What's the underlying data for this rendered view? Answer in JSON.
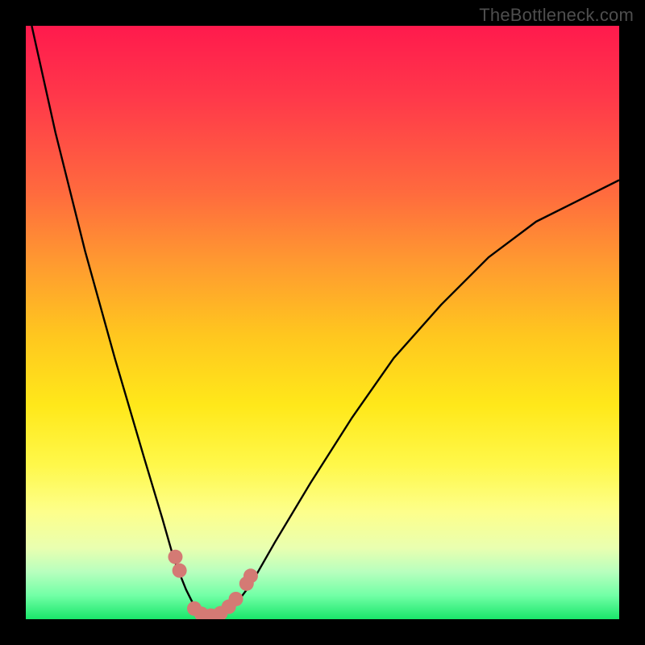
{
  "watermark": "TheBottleneck.com",
  "chart_data": {
    "type": "line",
    "title": "",
    "xlabel": "",
    "ylabel": "",
    "xlim": [
      0,
      100
    ],
    "ylim": [
      0,
      100
    ],
    "grid": false,
    "series": [
      {
        "name": "bottleneck-curve",
        "color": "#000000",
        "x": [
          1,
          5,
          10,
          15,
          20,
          23,
          25,
          27,
          28.5,
          30,
          31.5,
          33,
          35,
          38,
          42,
          48,
          55,
          62,
          70,
          78,
          86,
          94,
          100
        ],
        "y": [
          100,
          82,
          62,
          44,
          27,
          17,
          10,
          5,
          2,
          0.5,
          0.3,
          0.5,
          2,
          6,
          13,
          23,
          34,
          44,
          53,
          61,
          67,
          71,
          74
        ]
      }
    ],
    "markers": {
      "name": "highlight-dots",
      "color": "#d47a74",
      "points": [
        {
          "x": 25.2,
          "y": 10.5
        },
        {
          "x": 25.9,
          "y": 8.2
        },
        {
          "x": 28.4,
          "y": 1.8
        },
        {
          "x": 29.6,
          "y": 0.9
        },
        {
          "x": 31.2,
          "y": 0.6
        },
        {
          "x": 32.8,
          "y": 1.0
        },
        {
          "x": 34.2,
          "y": 2.1
        },
        {
          "x": 35.4,
          "y": 3.4
        },
        {
          "x": 37.2,
          "y": 6.0
        },
        {
          "x": 37.9,
          "y": 7.3
        }
      ]
    }
  }
}
